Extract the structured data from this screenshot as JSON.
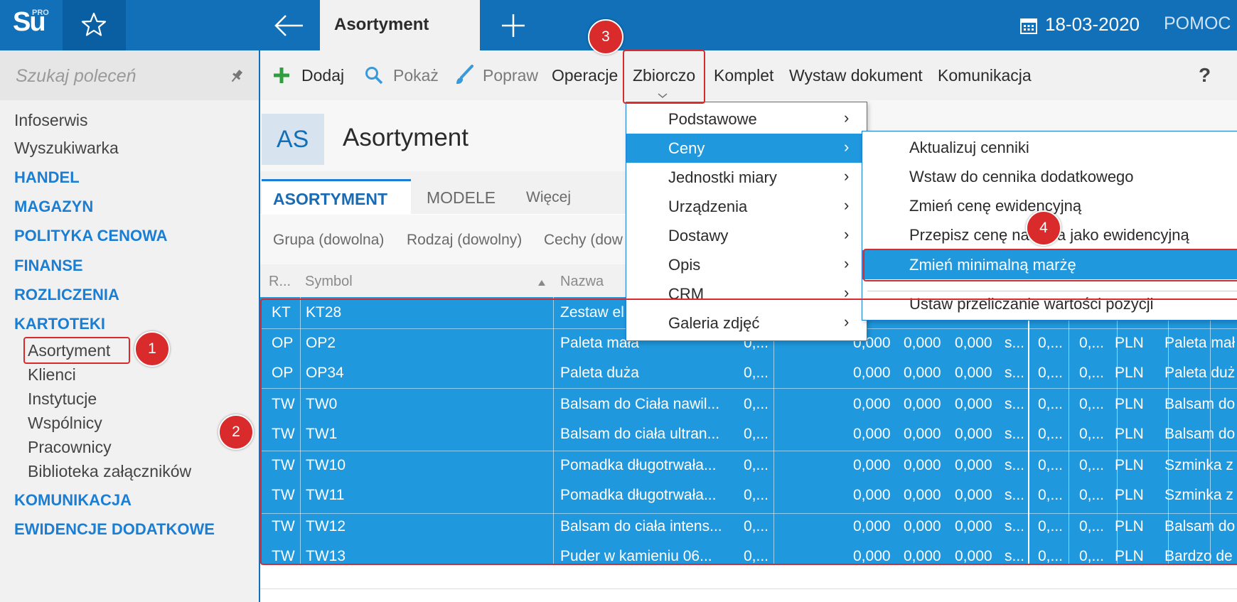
{
  "topbar": {
    "logo_text": "Su",
    "logo_badge": "PRO",
    "active_tab": "Asortyment",
    "date": "18-03-2020",
    "help": "POMOC"
  },
  "sidebar": {
    "search_placeholder": "Szukaj poleceń",
    "items": [
      {
        "label": "Infoserwis",
        "kind": "plain"
      },
      {
        "label": "Wyszukiwarka",
        "kind": "plain"
      },
      {
        "label": "HANDEL",
        "kind": "section"
      },
      {
        "label": "MAGAZYN",
        "kind": "section"
      },
      {
        "label": "POLITYKA CENOWA",
        "kind": "section"
      },
      {
        "label": "FINANSE",
        "kind": "section"
      },
      {
        "label": "ROZLICZENIA",
        "kind": "section"
      },
      {
        "label": "KARTOTEKI",
        "kind": "section"
      },
      {
        "label": "Asortyment",
        "kind": "sub"
      },
      {
        "label": "Klienci",
        "kind": "sub"
      },
      {
        "label": "Instytucje",
        "kind": "sub"
      },
      {
        "label": "Wspólnicy",
        "kind": "sub"
      },
      {
        "label": "Pracownicy",
        "kind": "sub"
      },
      {
        "label": "Biblioteka załączników",
        "kind": "sub"
      },
      {
        "label": "KOMUNIKACJA",
        "kind": "section"
      },
      {
        "label": "EWIDENCJE DODATKOWE",
        "kind": "section"
      }
    ]
  },
  "toolbar": {
    "add": "Dodaj",
    "show": "Pokaż",
    "edit": "Popraw",
    "operations": "Operacje",
    "bulk": "Zbiorczo",
    "kit": "Komplet",
    "issue_doc": "Wystaw dokument",
    "communication": "Komunikacja",
    "help": "?"
  },
  "header": {
    "badge": "AS",
    "title": "Asortyment"
  },
  "tabs": {
    "assortment": "ASORTYMENT",
    "models": "MODELE",
    "more": "Więcej"
  },
  "filters": {
    "group": "Grupa (dowolna)",
    "kind": "Rodzaj (dowolny)",
    "features": "Cechy (dow"
  },
  "grid": {
    "columns": {
      "r": "R...",
      "symbol": "Symbol",
      "name": "Nazwa"
    },
    "rows": [
      {
        "r": "KT",
        "symbol": "KT28",
        "name": "Zestaw el",
        "a": "",
        "b": "",
        "c": "",
        "d": "",
        "e": "",
        "f": "",
        "g": "",
        "cur": "",
        "desc": ""
      },
      {
        "r": "OP",
        "symbol": "OP2",
        "name": "Paleta mała",
        "a": "0,...",
        "b": "0,000",
        "c": "0,000",
        "d": "0,000",
        "e": "s...",
        "f": "0,...",
        "g": "0,...",
        "cur": "PLN",
        "desc": "Paleta mał"
      },
      {
        "r": "OP",
        "symbol": "OP34",
        "name": "Paleta duża",
        "a": "0,...",
        "b": "0,000",
        "c": "0,000",
        "d": "0,000",
        "e": "s...",
        "f": "0,...",
        "g": "0,...",
        "cur": "PLN",
        "desc": "Paleta duż"
      },
      {
        "r": "TW",
        "symbol": "TW0",
        "name": "Balsam do Ciała nawil...",
        "a": "0,...",
        "b": "0,000",
        "c": "0,000",
        "d": "0,000",
        "e": "s...",
        "f": "0,...",
        "g": "0,...",
        "cur": "PLN",
        "desc": "Balsam do"
      },
      {
        "r": "TW",
        "symbol": "TW1",
        "name": "Balsam do ciała ultran...",
        "a": "0,...",
        "b": "0,000",
        "c": "0,000",
        "d": "0,000",
        "e": "s...",
        "f": "0,...",
        "g": "0,...",
        "cur": "PLN",
        "desc": "Balsam do"
      },
      {
        "r": "TW",
        "symbol": "TW10",
        "name": "Pomadka długotrwała...",
        "a": "0,...",
        "b": "0,000",
        "c": "0,000",
        "d": "0,000",
        "e": "s...",
        "f": "0,...",
        "g": "0,...",
        "cur": "PLN",
        "desc": "Szminka z"
      },
      {
        "r": "TW",
        "symbol": "TW11",
        "name": "Pomadka długotrwała...",
        "a": "0,...",
        "b": "0,000",
        "c": "0,000",
        "d": "0,000",
        "e": "s...",
        "f": "0,...",
        "g": "0,...",
        "cur": "PLN",
        "desc": "Szminka z"
      },
      {
        "r": "TW",
        "symbol": "TW12",
        "name": "Balsam do ciała intens...",
        "a": "0,...",
        "b": "0,000",
        "c": "0,000",
        "d": "0,000",
        "e": "s...",
        "f": "0,...",
        "g": "0,...",
        "cur": "PLN",
        "desc": "Balsam do"
      },
      {
        "r": "TW",
        "symbol": "TW13",
        "name": "Puder w kamieniu 06...",
        "a": "0,...",
        "b": "0,000",
        "c": "0,000",
        "d": "0,000",
        "e": "s...",
        "f": "0,...",
        "g": "0,...",
        "cur": "PLN",
        "desc": "Bardzo de"
      }
    ]
  },
  "bulk_menu": {
    "items": [
      "Podstawowe",
      "Ceny",
      "Jednostki miary",
      "Urządzenia",
      "Dostawy",
      "Opis",
      "CRM",
      "Galeria zdjęć"
    ],
    "arrow": "›"
  },
  "prices_submenu": {
    "items": [
      "Aktualizuj cenniki",
      "Wstaw do cennika dodatkowego",
      "Zmień cenę ewidencyjną",
      "Przepisz cenę nabycia jako ewidencyjną",
      "Zmień minimalną marżę",
      "Ustaw przeliczanie wartości pozycji"
    ]
  },
  "markers": [
    "1",
    "2",
    "3",
    "4"
  ],
  "colors": {
    "brand_blue": "#1170b8",
    "selection_blue": "#1f98de",
    "section_blue": "#1a7ed4",
    "marker_red": "#d92b2b",
    "add_green": "#2e9e3e"
  }
}
